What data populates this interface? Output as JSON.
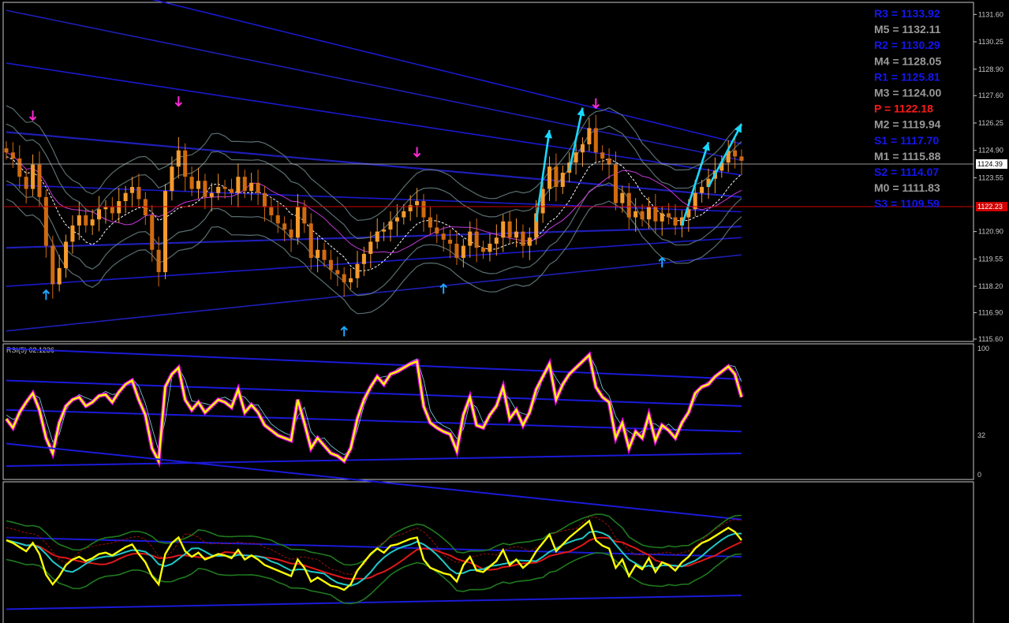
{
  "colors": {
    "background": "#000000",
    "frame": "#c8c8c8",
    "bull": "#f59b2c",
    "bear": "#d06a10",
    "envelope": "#1a1ad8",
    "band": "#5a6e70",
    "signal_up": "#1ea7ff",
    "signal_down": "#ff2bd6",
    "trend_arrow": "#19d8ff",
    "rsi_main": "#ffff00",
    "rsi_glow": "#ff00ff",
    "current_line": "#c8c8c8",
    "pivot_line": "#d00000"
  },
  "pivots": [
    {
      "label": "R3 = 1133.92",
      "color": "#1515f0"
    },
    {
      "label": "M5 = 1132.11",
      "color": "#9a9a9a"
    },
    {
      "label": "R2 = 1130.29",
      "color": "#1515f0"
    },
    {
      "label": "M4 = 1128.05",
      "color": "#9a9a9a"
    },
    {
      "label": "R1 = 1125.81",
      "color": "#1515f0"
    },
    {
      "label": "M3 = 1124.00",
      "color": "#9a9a9a"
    },
    {
      "label": "P  = 1122.18",
      "color": "#ff1a1a"
    },
    {
      "label": "M2 = 1119.94",
      "color": "#9a9a9a"
    },
    {
      "label": "S1 = 1117.70",
      "color": "#1515f0"
    },
    {
      "label": "M1 = 1115.88",
      "color": "#9a9a9a"
    },
    {
      "label": "S2 = 1114.07",
      "color": "#1515f0"
    },
    {
      "label": "M0 = 1111.83",
      "color": "#9a9a9a"
    },
    {
      "label": "S3 = 1109.59",
      "color": "#1515f0"
    }
  ],
  "chart_data": [
    {
      "type": "candlestick",
      "title": "",
      "price_axis_ticks": [
        "1131.60",
        "1130.25",
        "1128.90",
        "1127.60",
        "1126.25",
        "1124.90",
        "1123.55",
        "1120.90",
        "1119.55",
        "1118.20",
        "1116.90",
        "1115.60"
      ],
      "ylim": [
        1115.6,
        1132.0
      ],
      "current_price": "1124.39",
      "pivot_price": "1122.23",
      "close_series": [
        1124.8,
        1124.5,
        1123.6,
        1123.0,
        1124.2,
        1122.6,
        1120.2,
        1118.3,
        1119.1,
        1120.4,
        1121.2,
        1121.7,
        1121.2,
        1121.5,
        1122.0,
        1122.1,
        1121.8,
        1122.4,
        1122.8,
        1123.1,
        1122.5,
        1121.7,
        1120.0,
        1118.9,
        1122.9,
        1124.1,
        1124.9,
        1123.6,
        1123.0,
        1123.4,
        1122.6,
        1122.8,
        1123.1,
        1123.0,
        1122.8,
        1123.6,
        1122.9,
        1123.3,
        1122.8,
        1122.1,
        1121.7,
        1121.3,
        1121.0,
        1120.6,
        1122.1,
        1121.3,
        1119.6,
        1120.0,
        1119.5,
        1119.0,
        1118.8,
        1118.4,
        1118.6,
        1119.3,
        1119.8,
        1120.4,
        1120.9,
        1121.0,
        1121.4,
        1121.6,
        1121.9,
        1122.2,
        1122.4,
        1121.6,
        1121.1,
        1120.8,
        1120.5,
        1120.3,
        1119.6,
        1120.2,
        1120.9,
        1120.1,
        1119.9,
        1120.3,
        1120.6,
        1121.4,
        1120.6,
        1120.9,
        1120.2,
        1120.6,
        1121.8,
        1123.0,
        1124.1,
        1123.1,
        1123.8,
        1124.3,
        1124.8,
        1125.2,
        1126.0,
        1124.8,
        1124.5,
        1124.2,
        1122.3,
        1122.8,
        1121.6,
        1121.9,
        1121.5,
        1122.1,
        1121.4,
        1121.8,
        1121.6,
        1121.2,
        1121.6,
        1122.0,
        1122.8,
        1123.1,
        1123.5,
        1123.9,
        1124.3,
        1124.9,
        1124.6,
        1124.39
      ],
      "signals": [
        {
          "kind": "down",
          "index": 4
        },
        {
          "kind": "up",
          "index": 6
        },
        {
          "kind": "down",
          "index": 26
        },
        {
          "kind": "up",
          "index": 51
        },
        {
          "kind": "down",
          "index": 62
        },
        {
          "kind": "up",
          "index": 66
        },
        {
          "kind": "down",
          "index": 89
        },
        {
          "kind": "up",
          "index": 99
        }
      ],
      "trend_arrows": [
        {
          "from": 80,
          "to": 82
        },
        {
          "from": 85,
          "to": 87
        },
        {
          "from": 102,
          "to": 106
        },
        {
          "from": 106,
          "to": 111
        }
      ]
    },
    {
      "type": "line",
      "title": "RSI(5) 62.1236",
      "ylim": [
        0,
        100
      ],
      "ticks": [
        "100",
        "32",
        "0"
      ],
      "series": [
        {
          "values": [
            45,
            38,
            50,
            58,
            65,
            52,
            30,
            18,
            42,
            55,
            60,
            62,
            55,
            58,
            63,
            64,
            58,
            66,
            72,
            75,
            60,
            48,
            22,
            12,
            70,
            80,
            85,
            60,
            52,
            58,
            50,
            55,
            60,
            58,
            54,
            68,
            50,
            56,
            50,
            40,
            36,
            32,
            30,
            28,
            60,
            42,
            22,
            30,
            24,
            18,
            16,
            12,
            22,
            45,
            60,
            70,
            78,
            72,
            80,
            82,
            85,
            88,
            90,
            55,
            42,
            38,
            35,
            33,
            20,
            48,
            62,
            40,
            38,
            48,
            55,
            70,
            45,
            52,
            40,
            50,
            68,
            78,
            88,
            60,
            72,
            80,
            85,
            90,
            95,
            70,
            62,
            58,
            30,
            42,
            22,
            35,
            30,
            48,
            28,
            40,
            36,
            30,
            42,
            50,
            65,
            70,
            72,
            78,
            82,
            86,
            80,
            62
          ]
        }
      ]
    },
    {
      "type": "line",
      "title": "",
      "series": [
        {
          "values": [
            60,
            58,
            55,
            52,
            58,
            50,
            35,
            28,
            34,
            42,
            46,
            48,
            45,
            47,
            50,
            51,
            49,
            52,
            55,
            57,
            50,
            44,
            34,
            28,
            50,
            58,
            62,
            52,
            48,
            51,
            46,
            48,
            50,
            49,
            47,
            53,
            46,
            49,
            46,
            42,
            40,
            38,
            36,
            34,
            46,
            40,
            30,
            33,
            30,
            27,
            26,
            24,
            28,
            38,
            44,
            50,
            54,
            51,
            56,
            57,
            59,
            61,
            62,
            46,
            40,
            38,
            36,
            35,
            30,
            42,
            48,
            38,
            37,
            41,
            45,
            53,
            42,
            46,
            40,
            44,
            52,
            58,
            64,
            52,
            57,
            62,
            66,
            70,
            74,
            60,
            56,
            54,
            40,
            46,
            34,
            42,
            39,
            47,
            37,
            44,
            42,
            38,
            44,
            48,
            54,
            58,
            60,
            63,
            66,
            69,
            66,
            60
          ]
        }
      ]
    }
  ]
}
